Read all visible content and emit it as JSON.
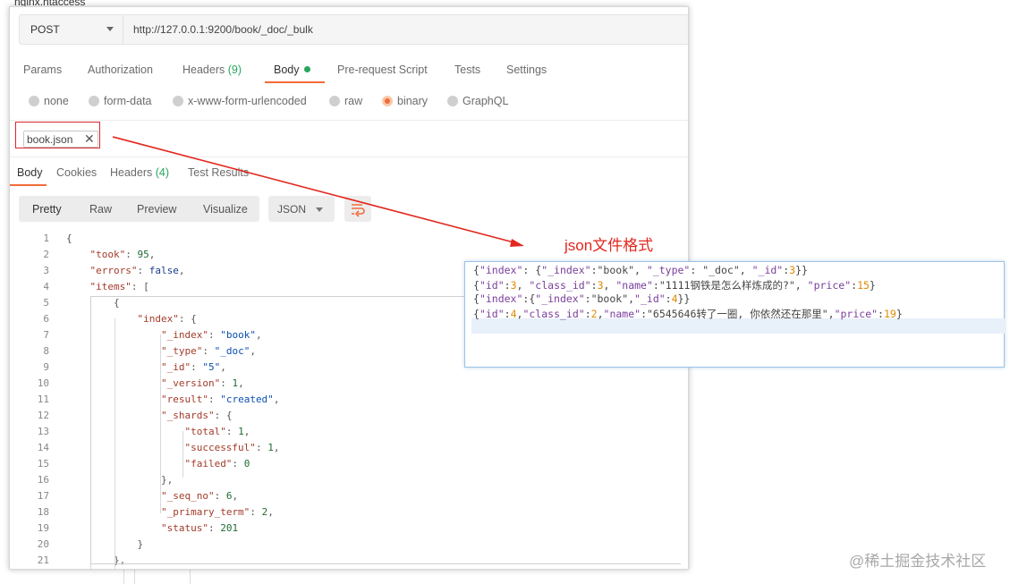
{
  "background": {
    "tab_label": "nginx.htaccess"
  },
  "request": {
    "method": "POST",
    "url": "http://127.0.0.1:9200/book/_doc/_bulk"
  },
  "request_tabs": {
    "params": "Params",
    "authorization": "Authorization",
    "headers": "Headers",
    "headers_count": "(9)",
    "body": "Body",
    "pre_request": "Pre-request Script",
    "tests": "Tests",
    "settings": "Settings"
  },
  "body_modes": {
    "none": "none",
    "form_data": "form-data",
    "urlencoded": "x-www-form-urlencoded",
    "raw": "raw",
    "binary": "binary",
    "graphql": "GraphQL",
    "selected": "binary"
  },
  "file": {
    "name": "book.json",
    "remove": "✕"
  },
  "response_tabs": {
    "body": "Body",
    "cookies": "Cookies",
    "headers": "Headers",
    "headers_count": "(4)",
    "test_results": "Test Results"
  },
  "view": {
    "pretty": "Pretty",
    "raw": "Raw",
    "preview": "Preview",
    "visualize": "Visualize",
    "format": "JSON"
  },
  "code_lines": [
    {
      "n": "1",
      "text": "{"
    },
    {
      "n": "2",
      "text": "    \"took\": 95,"
    },
    {
      "n": "3",
      "text": "    \"errors\": false,"
    },
    {
      "n": "4",
      "text": "    \"items\": ["
    },
    {
      "n": "5",
      "text": "        {"
    },
    {
      "n": "6",
      "text": "            \"index\": {"
    },
    {
      "n": "7",
      "text": "                \"_index\": \"book\","
    },
    {
      "n": "8",
      "text": "                \"_type\": \"_doc\","
    },
    {
      "n": "9",
      "text": "                \"_id\": \"5\","
    },
    {
      "n": "10",
      "text": "                \"_version\": 1,"
    },
    {
      "n": "11",
      "text": "                \"result\": \"created\","
    },
    {
      "n": "12",
      "text": "                \"_shards\": {"
    },
    {
      "n": "13",
      "text": "                    \"total\": 1,"
    },
    {
      "n": "14",
      "text": "                    \"successful\": 1,"
    },
    {
      "n": "15",
      "text": "                    \"failed\": 0"
    },
    {
      "n": "16",
      "text": "                },"
    },
    {
      "n": "17",
      "text": "                \"_seq_no\": 6,"
    },
    {
      "n": "18",
      "text": "                \"_primary_term\": 2,"
    },
    {
      "n": "19",
      "text": "                \"status\": 201"
    },
    {
      "n": "20",
      "text": "            }"
    },
    {
      "n": "21",
      "text": "        },"
    }
  ],
  "callout": {
    "label": "json文件格式"
  },
  "json_file_lines": [
    "{\"index\": {\"_index\":\"book\", \"_type\": \"_doc\", \"_id\":3}}",
    "{\"id\":3, \"class_id\":3, \"name\":\"1111钢铁是怎么样炼成的?\", \"price\":15}",
    "{\"index\":{\"_index\":\"book\",\"_id\":4}}",
    "{\"id\":4,\"class_id\":2,\"name\":\"6545646转了一圈, 你依然还在那里\",\"price\":19}"
  ],
  "watermark": "@稀土掘金技术社区",
  "colors": {
    "accent": "#f26b3a",
    "count_green": "#26a65b",
    "annotation_red": "#e2271f"
  }
}
